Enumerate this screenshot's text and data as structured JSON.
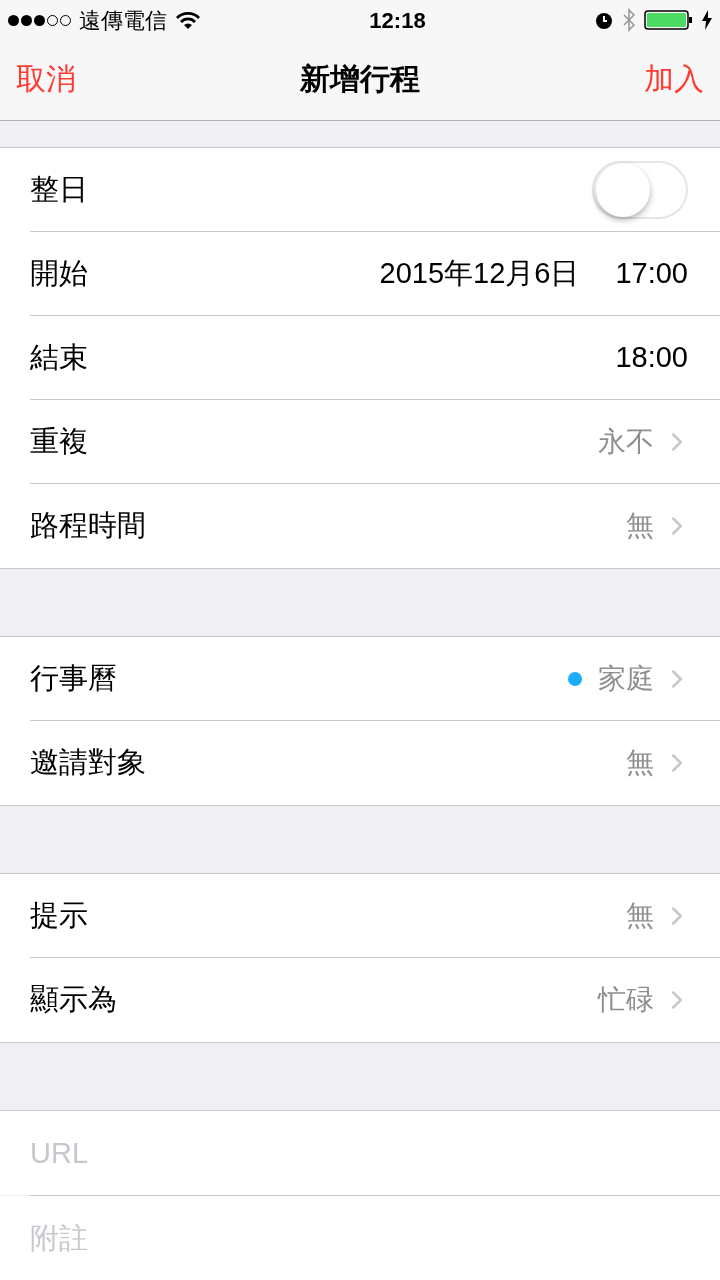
{
  "status_bar": {
    "carrier": "遠傳電信",
    "time": "12:18"
  },
  "nav": {
    "cancel": "取消",
    "title": "新增行程",
    "add": "加入"
  },
  "sections": [
    {
      "rows": [
        {
          "kind": "toggle",
          "label": "整日",
          "on": false
        },
        {
          "kind": "datetime",
          "label": "開始",
          "date": "2015年12月6日",
          "time": "17:00"
        },
        {
          "kind": "datetime",
          "label": "結束",
          "time": "18:00"
        },
        {
          "kind": "detail",
          "label": "重複",
          "value": "永不"
        },
        {
          "kind": "detail",
          "label": "路程時間",
          "value": "無"
        }
      ]
    },
    {
      "rows": [
        {
          "kind": "detail",
          "label": "行事曆",
          "value": "家庭",
          "color": "#1badf8"
        },
        {
          "kind": "detail",
          "label": "邀請對象",
          "value": "無"
        }
      ]
    },
    {
      "rows": [
        {
          "kind": "detail",
          "label": "提示",
          "value": "無"
        },
        {
          "kind": "detail",
          "label": "顯示為",
          "value": "忙碌"
        }
      ]
    }
  ],
  "fields": [
    {
      "placeholder": "URL"
    },
    {
      "placeholder": "附註"
    }
  ]
}
